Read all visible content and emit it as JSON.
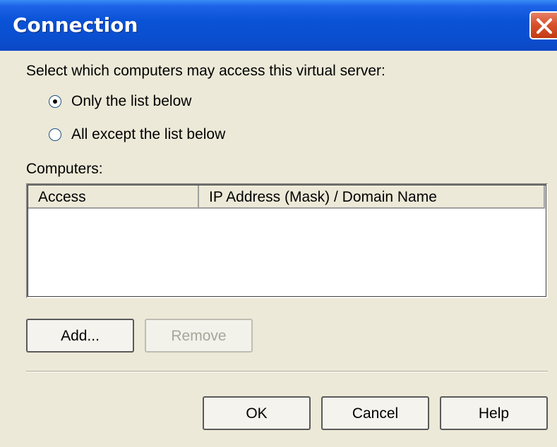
{
  "window": {
    "title": "Connection"
  },
  "prompt": "Select which computers may access this virtual server:",
  "access_options": [
    {
      "label": "Only the list below",
      "selected": true
    },
    {
      "label": "All except the list below",
      "selected": false
    }
  ],
  "computers": {
    "label": "Computers:",
    "columns": [
      "Access",
      "IP Address (Mask) / Domain Name"
    ],
    "rows": []
  },
  "list_buttons": {
    "add": "Add...",
    "remove": "Remove"
  },
  "dialog_buttons": {
    "ok": "OK",
    "cancel": "Cancel",
    "help": "Help"
  },
  "colors": {
    "title_bar": "#0a52d6",
    "close_button": "#d8532c",
    "dialog_bg": "#ece9d8"
  }
}
